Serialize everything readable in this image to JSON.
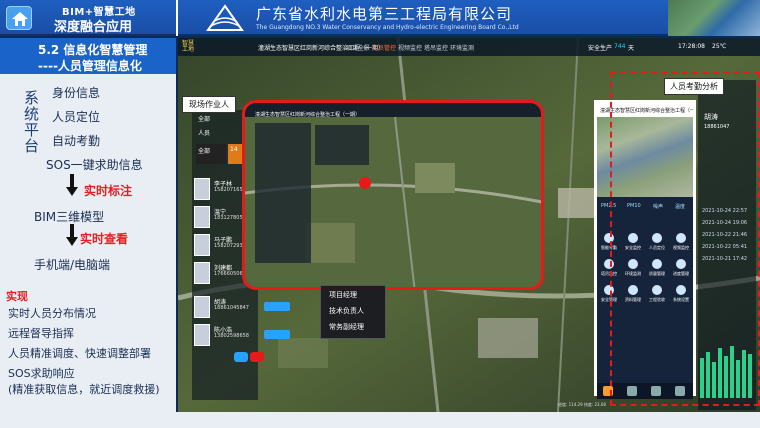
{
  "header": {
    "app_line1": "BIM+智慧工地",
    "app_line2": "深度融合应用",
    "org_name_cn": "广东省水利水电第三工程局有限公司",
    "org_name_en": "The Guangdong NO.3 Water Conservancy and Hydro-electric Engineering Board Co.,Ltd"
  },
  "left_panel": {
    "title_line1": "5.2 信息化智慧管理",
    "title_line2": "----人员管理信息化",
    "system_label": "系统平台",
    "system_items": [
      "身份信息",
      "人员定位",
      "自动考勤",
      "SOS一键求助信息"
    ],
    "tag_realtime_mark": "实时标注",
    "bim_model": "BIM三维模型",
    "tag_realtime_view": "实时查看",
    "terminal": "手机端/电脑端",
    "impl_label": "实现",
    "impl_items": [
      "实时人员分布情况",
      "远程督导指挥",
      "人员精准调度、快速调整部署",
      "SOS求助响应",
      "(精准获取信息，就近调度救援)"
    ]
  },
  "main": {
    "logo_text": "智慧工地",
    "title": "潼湖生态智慧区红岗新河综合整治工程（一期）",
    "nav": [
      "项目全景",
      "人员管控",
      "视频监控",
      "塔吊监控",
      "环境监测"
    ],
    "nav_active_index": 1,
    "status": {
      "label": "安全生产",
      "days": "744",
      "unit": "天",
      "time": "17:28:08",
      "temp": "25℃"
    },
    "callout_workers": "现场作业人",
    "callout_attendance": "人员考勤分析",
    "side_list": {
      "tabs": [
        "全部",
        "人员"
      ],
      "total_label": "全部",
      "total_value": "14",
      "persons": [
        {
          "name": "李子林",
          "phone": "15820716597"
        },
        {
          "name": "温宁",
          "phone": "18312780535"
        },
        {
          "name": "马子鹏",
          "phone": "15820729315"
        },
        {
          "name": "刘建都",
          "phone": "17666050661"
        },
        {
          "name": "胡涛",
          "phone": "18861045847"
        },
        {
          "name": "陈小浩",
          "phone": "13802598658"
        }
      ]
    },
    "popup_menu": [
      "项目经理",
      "技术负责人",
      "常务副经理"
    ],
    "phone": {
      "header": "潼湖生态智慧区红岗新河综合整治工程（一期）",
      "stats": [
        "PM2.5",
        "PM10",
        "噪声",
        "温度"
      ],
      "icons": [
        "智能考勤",
        "安全监控",
        "人员定位",
        "视频监控",
        "塔吊监控",
        "环境监测",
        "质量管理",
        "进度管理",
        "安全管理",
        "资料管理",
        "工程验收",
        "系统设置",
        "我的"
      ]
    },
    "right_panel": {
      "name": "胡涛",
      "phone": "18861047",
      "logs": [
        "2021-10-24 22:57",
        "2021-10-24 19:06",
        "2021-10-22 21:46",
        "2021-10-22 05:41",
        "2021-10-21 17:42"
      ]
    },
    "bottom_coords": "经度: 114.29 纬度: 23.08"
  },
  "colors": {
    "brand_blue": "#1a63c9",
    "alert_red": "#e62020",
    "accent_orange": "#ff6a3a"
  }
}
